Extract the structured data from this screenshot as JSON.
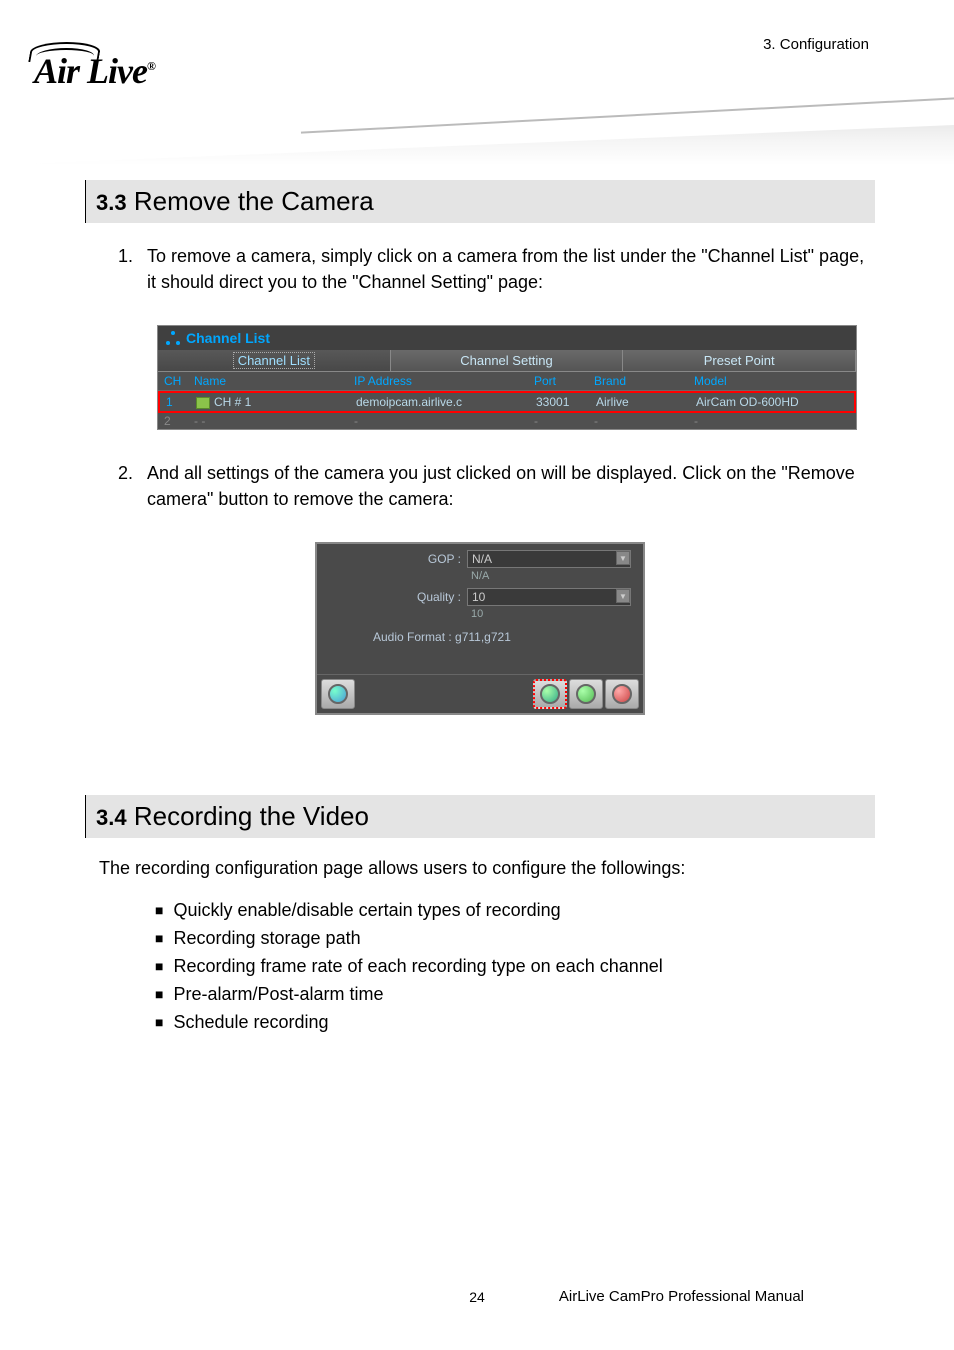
{
  "header": {
    "right": "3. Configuration"
  },
  "logo": {
    "text": "Air Live",
    "reg": "®"
  },
  "section33": {
    "num": "3.3",
    "title": "Remove the Camera",
    "step1": {
      "num": "1.",
      "text": "To remove a camera, simply click on a camera from the list under the \"Channel List\" page, it should direct you to the \"Channel Setting\" page:"
    },
    "step2": {
      "num": "2.",
      "text": "And all settings of the camera you just clicked on will be displayed. Click on the \"Remove camera\" button to remove the camera:"
    }
  },
  "shot1": {
    "title": "Channel List",
    "tabs": {
      "t1": "Channel List",
      "t2": "Channel Setting",
      "t3": "Preset Point"
    },
    "headers": {
      "ch": "CH",
      "name": "Name",
      "ip": "IP Address",
      "port": "Port",
      "brand": "Brand",
      "model": "Model"
    },
    "row1": {
      "ch": "1",
      "name": "CH # 1",
      "ip": "demoipcam.airlive.c",
      "port": "33001",
      "brand": "Airlive",
      "model": "AirCam OD-600HD"
    },
    "row2": {
      "ch": "2",
      "name": "-   -",
      "ip": "-",
      "port": "-",
      "brand": "-",
      "model": "-"
    }
  },
  "shot2": {
    "gop_label": "GOP :",
    "gop_val": "N/A",
    "gop_sub": "N/A",
    "quality_label": "Quality :",
    "quality_val": "10",
    "quality_sub": "10",
    "audio_label": "Audio Format :",
    "audio_val": "g711,g721"
  },
  "section34": {
    "num": "3.4",
    "title": "Recording the Video",
    "intro": "The recording configuration page allows users to configure the followings:",
    "b1": "Quickly enable/disable certain types of recording",
    "b2": "Recording storage path",
    "b3": "Recording frame rate of each recording type on each channel",
    "b4": "Pre-alarm/Post-alarm time",
    "b5": "Schedule recording"
  },
  "footer": {
    "page": "24",
    "manual": "AirLive CamPro Professional Manual"
  }
}
